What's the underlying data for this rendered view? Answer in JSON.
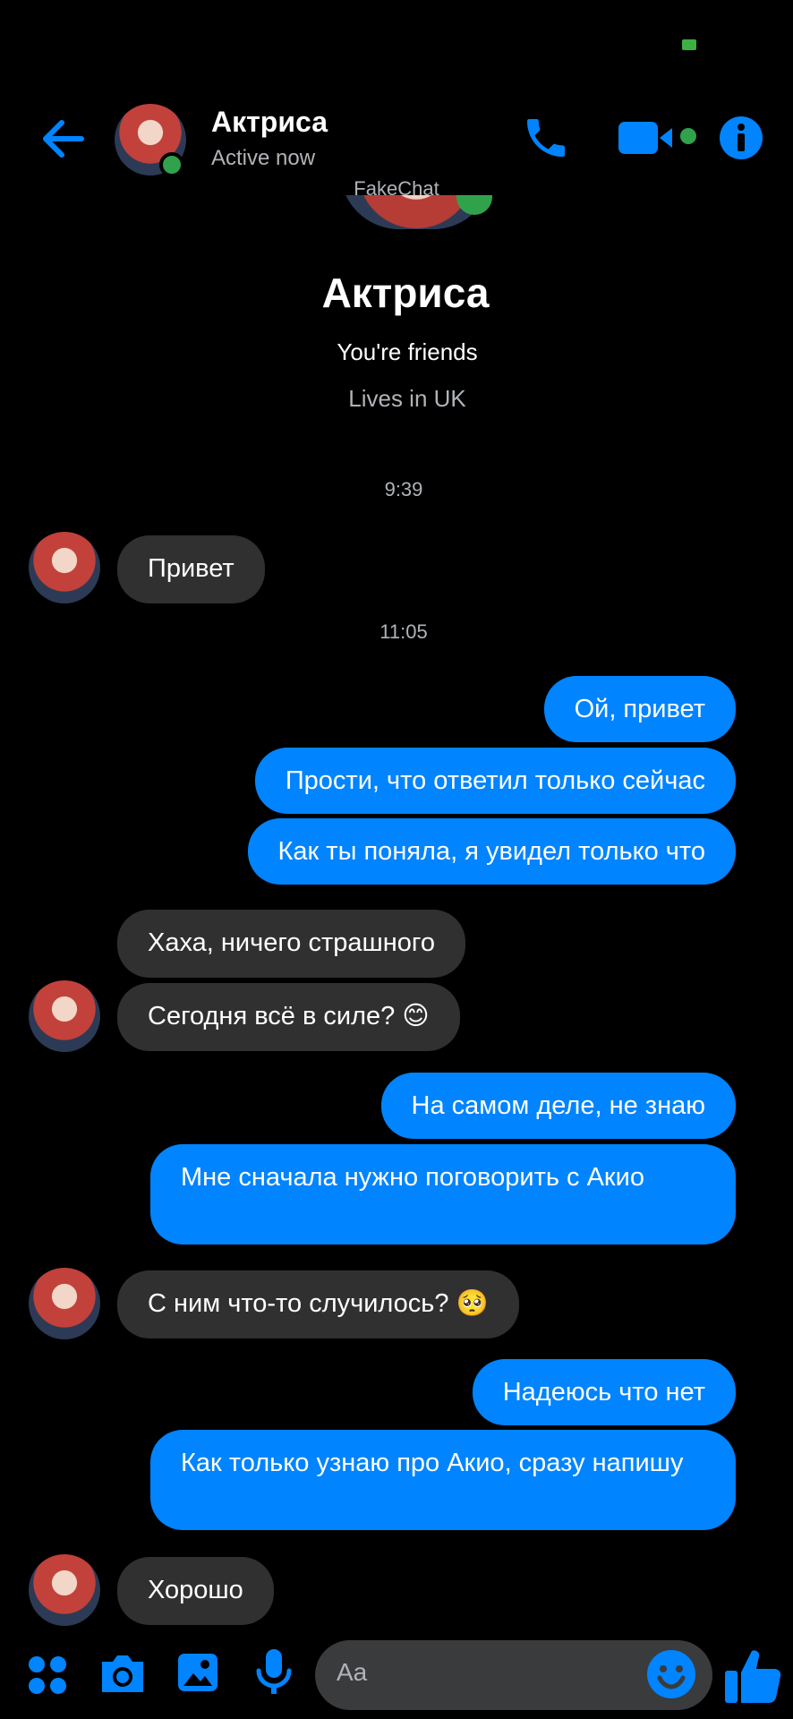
{
  "header": {
    "name": "Актриса",
    "status": "Active now"
  },
  "watermark": "FakeChat",
  "profile": {
    "name": "Актриса",
    "relation": "You're friends",
    "location": "Lives in UK"
  },
  "timestamps": [
    "9:39",
    "11:05"
  ],
  "messages": {
    "m1": "Привет",
    "m2": "Ой, привет",
    "m3": "Прости, что ответил только сейчас",
    "m4": "Как ты поняла, я увидел только что",
    "m5": "Хаха, ничего страшного",
    "m6": "Сегодня всё в силе? 😊",
    "m7": "На самом деле, не знаю",
    "m8": "Мне сначала нужно поговорить с Акио",
    "m9": "С ним что-то случилось? 🥺",
    "m10": "Надеюсь что нет",
    "m11": "Как только узнаю про Акио, сразу напишу",
    "m12": "Хорошо"
  },
  "composer": {
    "placeholder": "Aa"
  },
  "colors": {
    "accent": "#0084ff",
    "incoming_bubble": "#303030",
    "online": "#31a24c"
  },
  "icons": [
    "back-arrow-icon",
    "phone-icon",
    "video-icon",
    "info-icon",
    "apps-icon",
    "camera-icon",
    "gallery-icon",
    "microphone-icon",
    "emoji-icon",
    "thumbs-up-icon"
  ]
}
